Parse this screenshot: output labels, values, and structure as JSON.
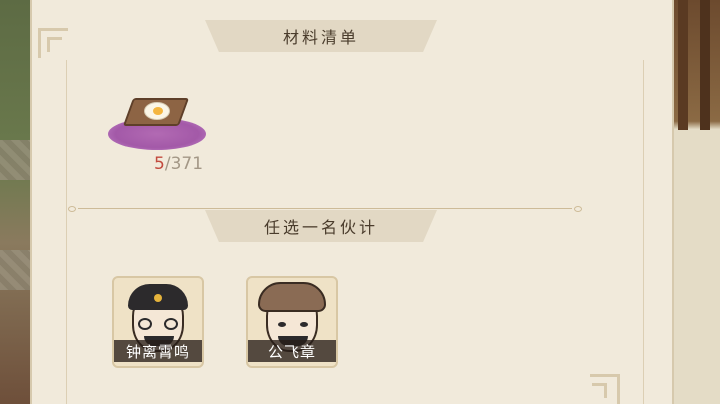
{
  "materials_section": {
    "title": "材料清单",
    "items": [
      {
        "icon": "fried-egg-tray-icon",
        "have": "5",
        "separator": "/",
        "need": "371"
      }
    ]
  },
  "partners_section": {
    "title": "任选一名伙计",
    "partners": [
      {
        "name": "钟离霄鸣",
        "avatar": "official-hat-glasses-avatar"
      },
      {
        "name": "公飞章",
        "avatar": "brown-turban-avatar"
      }
    ]
  },
  "colors": {
    "panel_bg": "#f1eadb",
    "banner_bg": "#e2d8c4",
    "count_have": "#c24a3e",
    "count_need": "#a39786",
    "item_glow": "#a359a8"
  }
}
